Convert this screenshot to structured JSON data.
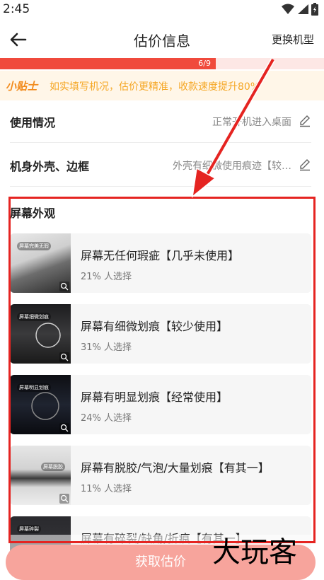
{
  "status_bar": {
    "time": "2:45"
  },
  "header": {
    "title": "估价信息",
    "change_model": "更换机型"
  },
  "progress": {
    "text": "6/9",
    "fraction": 0.667
  },
  "tip": {
    "label": "小贴士",
    "text": "如实填写机况，估价更精准，收款速度提升80%"
  },
  "rows": [
    {
      "label": "使用情况",
      "value": "正常开机进入桌面"
    },
    {
      "label": "机身外壳、边框",
      "value": "外壳有细微使用痕迹【较…"
    }
  ],
  "section": {
    "title": "屏幕外观",
    "options": [
      {
        "title": "屏幕无任何瑕疵【几乎未使用】",
        "ratio": "21% 人选择",
        "thumb_tag": "屏幕完美无瑕"
      },
      {
        "title": "屏幕有细微划痕【较少使用】",
        "ratio": "31% 人选择",
        "thumb_tag": "屏幕细微划痕"
      },
      {
        "title": "屏幕有明显划痕【经常使用】",
        "ratio": "24% 人选择",
        "thumb_tag": "屏幕明显划痕"
      },
      {
        "title": "屏幕有脱胶/气泡/大量划痕【有其一】",
        "ratio": "11% 人选择",
        "thumb_tag": "屏幕脱胶"
      },
      {
        "title": "屏幕有碎裂/缺角/折痕【有其一】",
        "ratio": "",
        "thumb_tag": "屏幕碎裂"
      }
    ]
  },
  "footer": {
    "button_label": "获取估价"
  },
  "watermark": "大玩客",
  "colors": {
    "accent": "#f04a3c",
    "annotation": "#e52421",
    "tip_text": "#f5a623",
    "button": "#f7a49c"
  }
}
